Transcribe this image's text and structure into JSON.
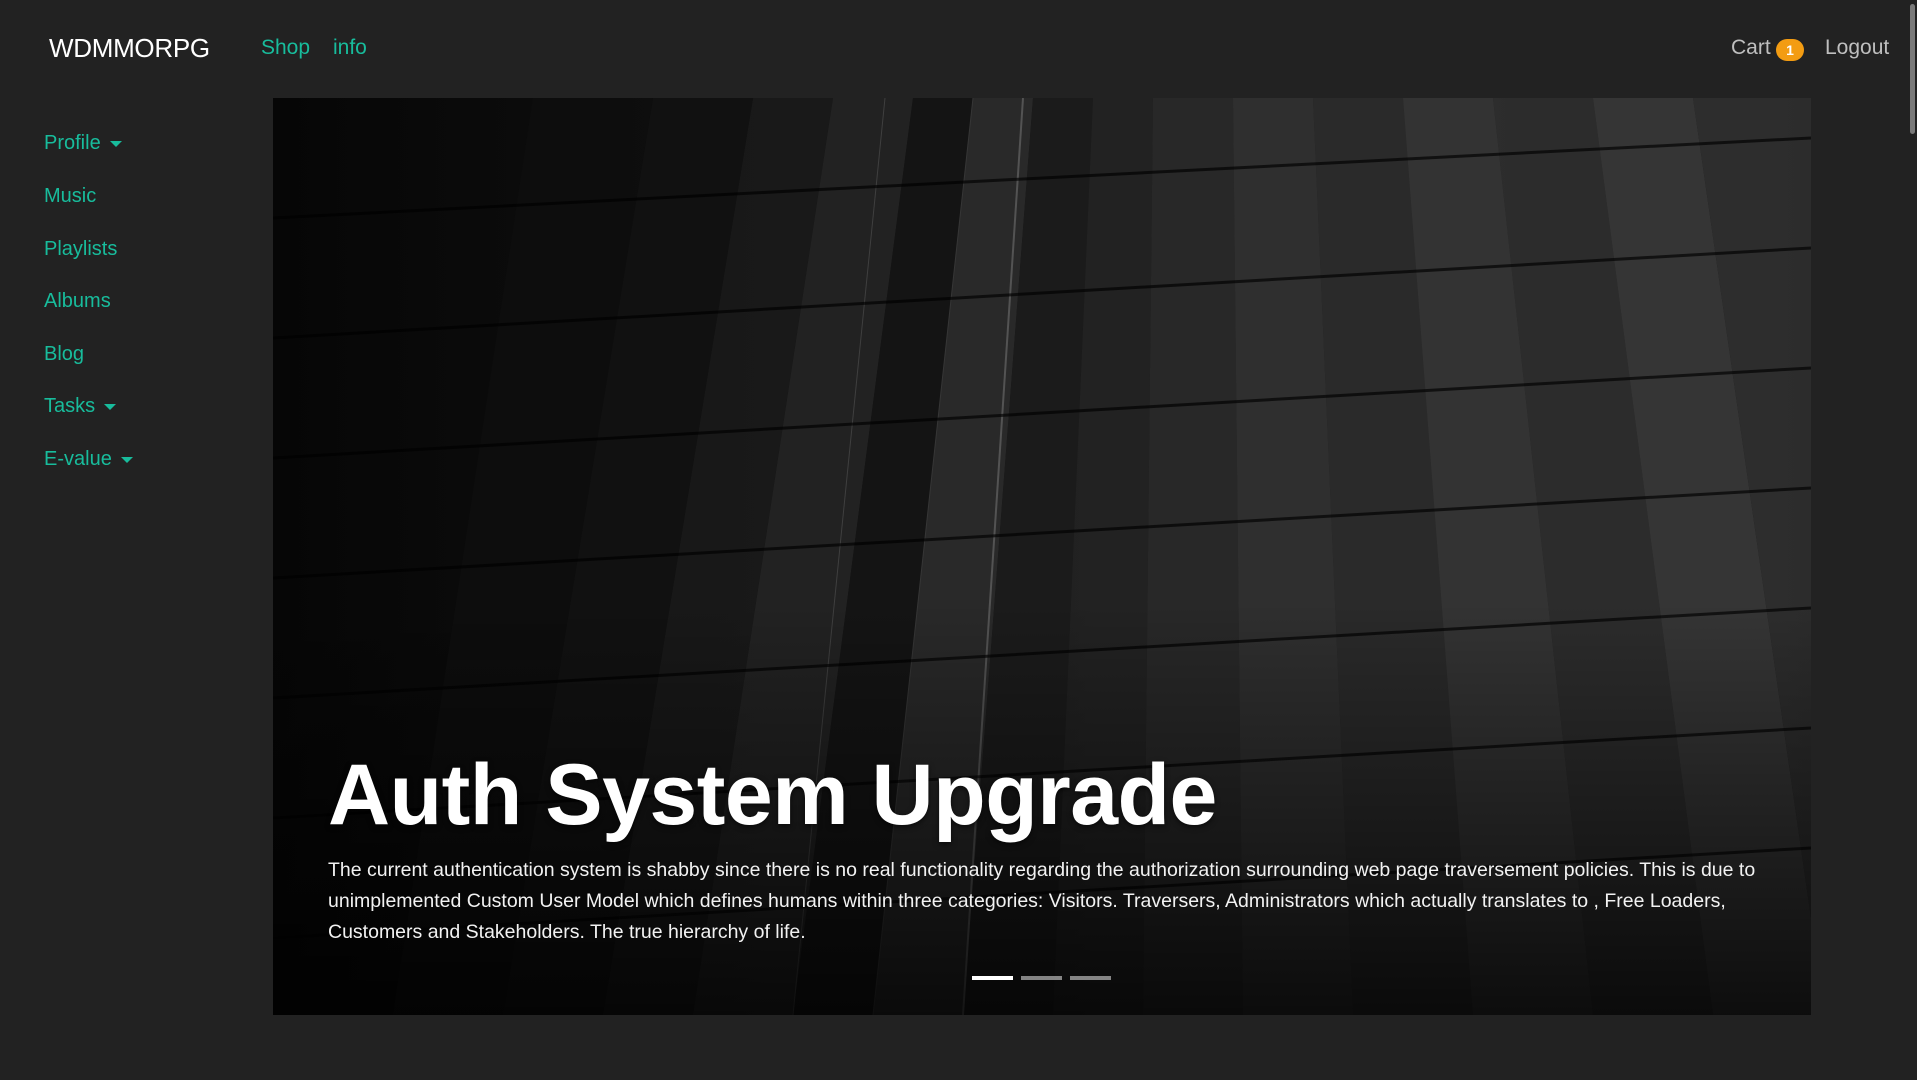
{
  "navbar": {
    "brand": "WDMMORPG",
    "links": [
      "Shop",
      "info"
    ],
    "cart_label": "Cart",
    "cart_count": "1",
    "logout_label": "Logout"
  },
  "sidebar": {
    "items": [
      {
        "label": "Profile",
        "dropdown": true
      },
      {
        "label": "Music",
        "dropdown": false
      },
      {
        "label": "Playlists",
        "dropdown": false
      },
      {
        "label": "Albums",
        "dropdown": false
      },
      {
        "label": "Blog",
        "dropdown": false
      },
      {
        "label": "Tasks",
        "dropdown": true
      },
      {
        "label": "E-value",
        "dropdown": true
      }
    ]
  },
  "carousel": {
    "slide_count": 3,
    "active_index": 0,
    "title": "Auth System Upgrade",
    "text": "The current authentication system is shabby since there is no real functionality regarding the authorization surrounding web page traversement policies. This is due to unimplemented Custom User Model which defines humans within three categories: Visitors. Traversers, Administrators which actually translates to , Free Loaders, Customers and Stakeholders. The true hierarchy of life."
  },
  "colors": {
    "accent": "#18bc9c",
    "badge": "#f39c12",
    "background": "#222222"
  }
}
